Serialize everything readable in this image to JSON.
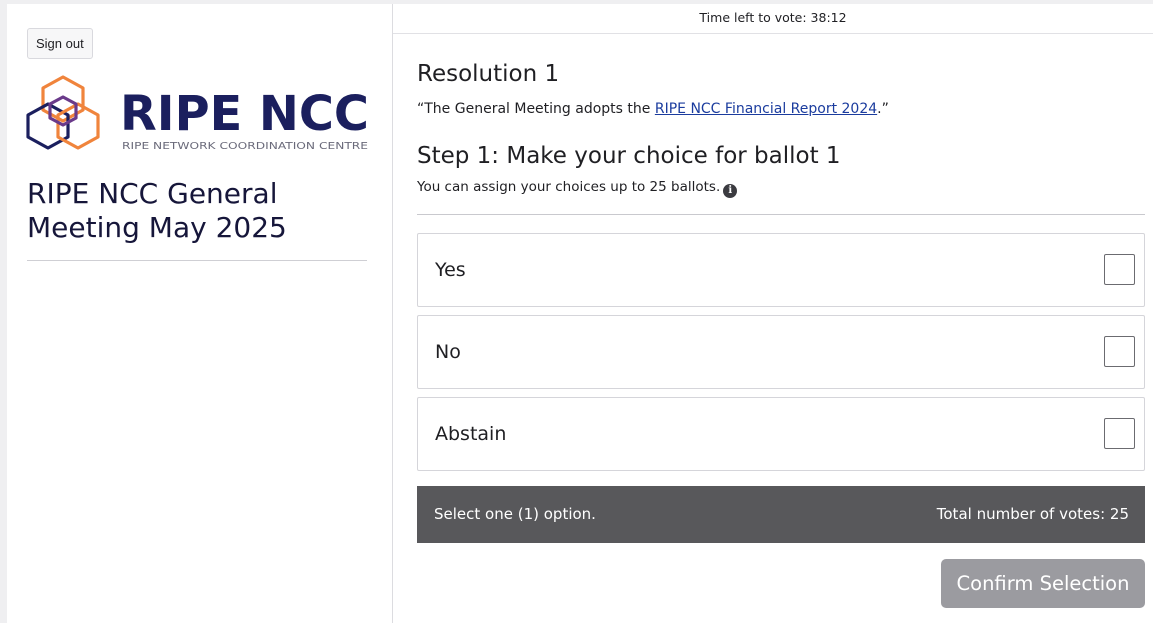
{
  "sidebar": {
    "sign_out_label": "Sign out",
    "logo": {
      "wordmark": "RIPE NCC",
      "tagline": "RIPE NETWORK COORDINATION CENTRE",
      "colors": {
        "navy": "#1b1f5e",
        "orange": "#f0843c",
        "purple": "#6a3a8a"
      }
    },
    "meeting_title": "RIPE NCC General Meeting May 2025"
  },
  "header": {
    "timer_text": "Time left to vote: 38:12"
  },
  "main": {
    "resolution_title": "Resolution 1",
    "resolution_quote_prefix": "“The General Meeting adopts the ",
    "resolution_link_text": "RIPE NCC Financial Report 2024",
    "resolution_quote_suffix": ".”",
    "step_title": "Step 1: Make your choice for ballot 1",
    "step_subtitle": "You can assign your choices up to 25 ballots.",
    "info_icon": "info-circle-icon",
    "options": [
      {
        "label": "Yes",
        "checked": false
      },
      {
        "label": "No",
        "checked": false
      },
      {
        "label": "Abstain",
        "checked": false
      }
    ],
    "status_bar": {
      "instruction": "Select one (1) option.",
      "total_votes": "Total number of votes: 25",
      "background": "#58585b"
    },
    "confirm_label": "Confirm Selection",
    "confirm_disabled_color": "#9b9ba0"
  }
}
